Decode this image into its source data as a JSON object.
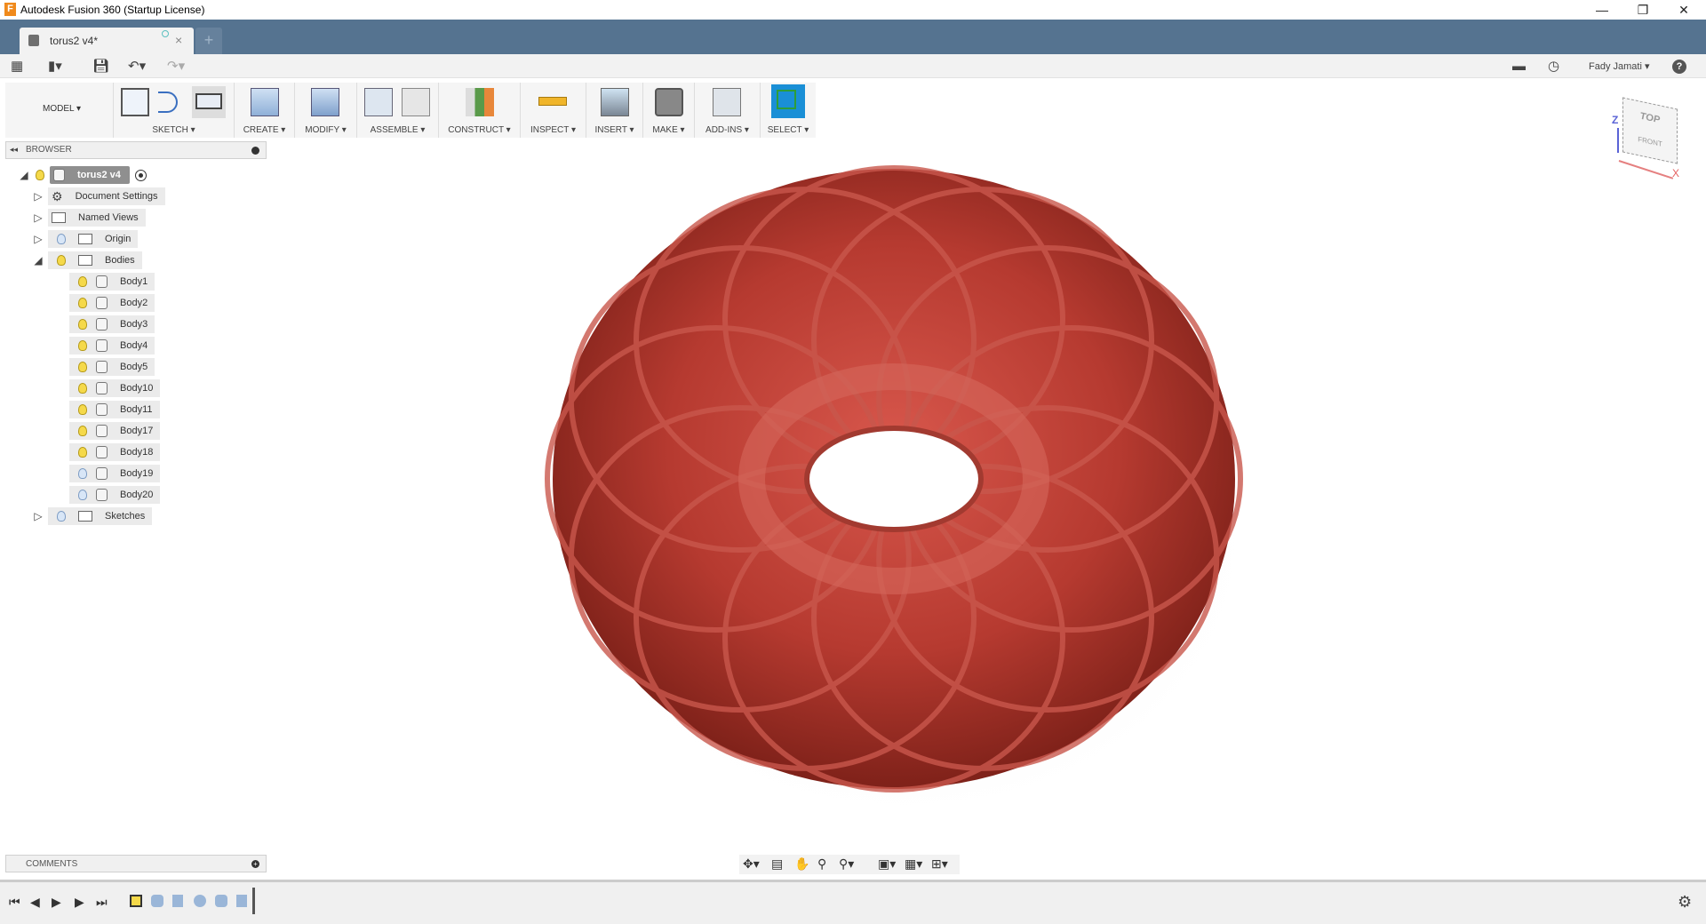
{
  "window": {
    "title": "Autodesk Fusion 360 (Startup License)",
    "app_icon": "F",
    "minimize": "—",
    "restore": "❐",
    "close": "✕"
  },
  "tab": {
    "label": "torus2 v4*",
    "close": "×",
    "new_tab": "+"
  },
  "quick_access": {
    "user": "Fady Jamati ▾",
    "help": "?"
  },
  "ribbon": {
    "workspace": "MODEL ▾",
    "groups": [
      "SKETCH ▾",
      "CREATE ▾",
      "MODIFY ▾",
      "ASSEMBLE ▾",
      "CONSTRUCT ▾",
      "INSPECT ▾",
      "INSERT ▾",
      "MAKE ▾",
      "ADD-INS ▾",
      "SELECT ▾"
    ]
  },
  "browser": {
    "title": "BROWSER",
    "root": "torus2 v4",
    "items": [
      {
        "label": "Document Settings"
      },
      {
        "label": "Named Views"
      },
      {
        "label": "Origin"
      },
      {
        "label": "Bodies"
      }
    ],
    "bodies": [
      "Body1",
      "Body2",
      "Body3",
      "Body4",
      "Body5",
      "Body10",
      "Body11",
      "Body17",
      "Body18",
      "Body19",
      "Body20"
    ],
    "bodies_visible": [
      true,
      true,
      true,
      true,
      true,
      true,
      true,
      true,
      true,
      false,
      false
    ],
    "sketches": "Sketches"
  },
  "comments": {
    "title": "COMMENTS"
  },
  "viewcube": {
    "top": "TOP",
    "front": "FRONT",
    "x": "X",
    "z": "Z"
  },
  "colors": {
    "tabbar": "#557390",
    "body": "#b63a30",
    "select": "#1a8fd6"
  }
}
